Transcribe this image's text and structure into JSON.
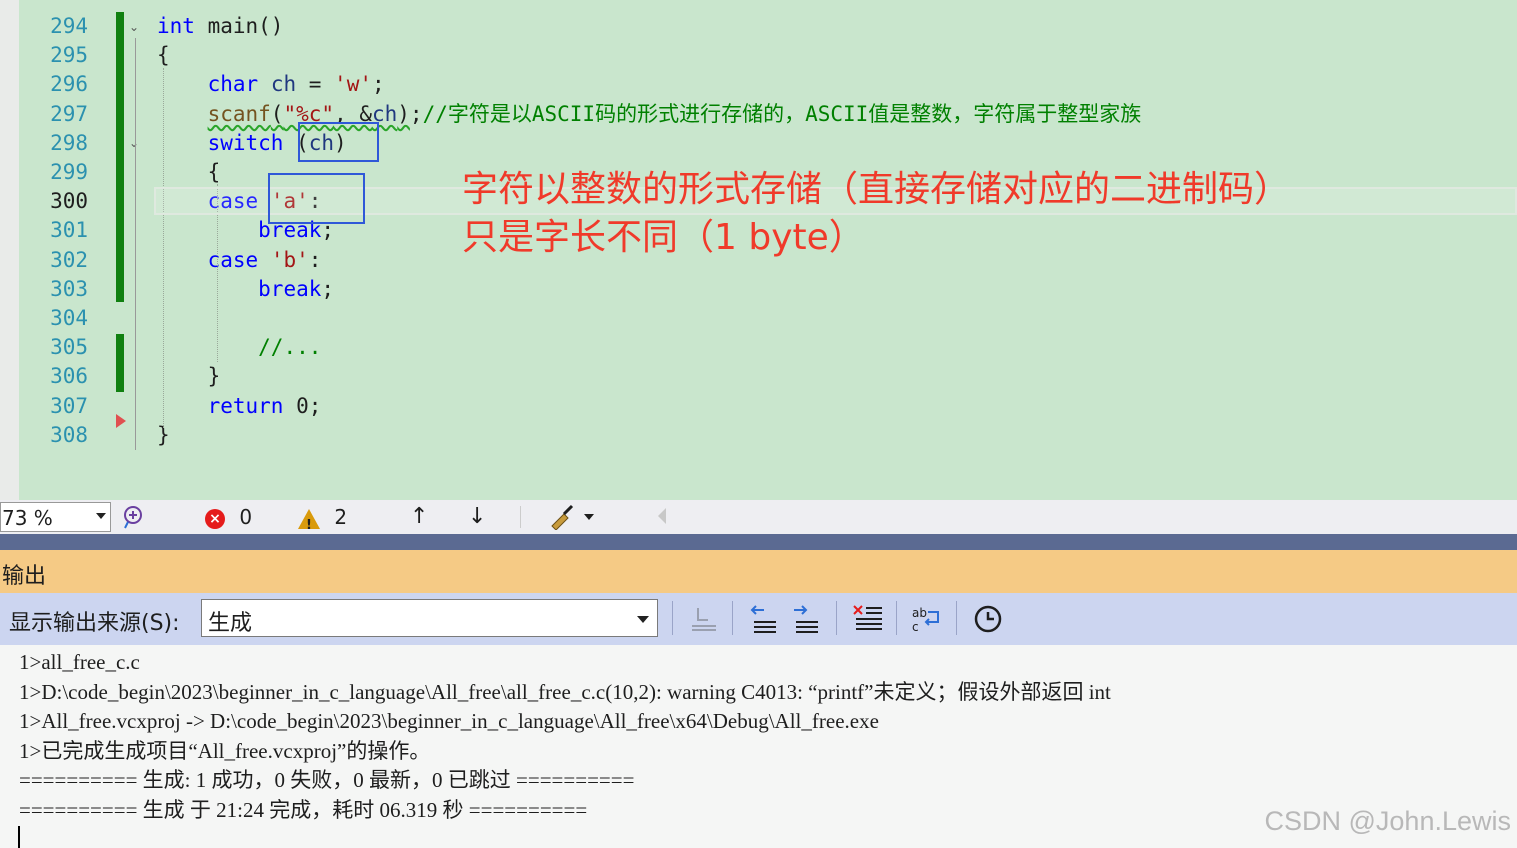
{
  "editor": {
    "lines": [
      {
        "num": "294",
        "tokens": [
          {
            "t": "int",
            "c": "kw"
          },
          {
            "t": " main()",
            "c": ""
          }
        ]
      },
      {
        "num": "295",
        "tokens": [
          {
            "t": "{",
            "c": ""
          }
        ]
      },
      {
        "num": "296",
        "tokens": [
          {
            "t": "    ",
            "c": ""
          },
          {
            "t": "char",
            "c": "kw"
          },
          {
            "t": " ",
            "c": ""
          },
          {
            "t": "ch",
            "c": "var"
          },
          {
            "t": " = ",
            "c": ""
          },
          {
            "t": "'w'",
            "c": "str"
          },
          {
            "t": ";",
            "c": ""
          }
        ]
      },
      {
        "num": "297",
        "tokens": [
          {
            "t": "    ",
            "c": ""
          },
          {
            "t": "scanf",
            "c": "fn sq"
          },
          {
            "t": "(",
            "c": "sq"
          },
          {
            "t": "\"%c\"",
            "c": "str sq"
          },
          {
            "t": ", &",
            "c": "sq"
          },
          {
            "t": "ch",
            "c": "var sq"
          },
          {
            "t": ")",
            "c": "sq"
          },
          {
            "t": ";",
            "c": ""
          },
          {
            "t": "//字符是以ASCII码的形式进行存储的，ASCII值是整数，字符属于整型家族",
            "c": "cmt"
          }
        ]
      },
      {
        "num": "298",
        "tokens": [
          {
            "t": "    ",
            "c": ""
          },
          {
            "t": "switch",
            "c": "kw"
          },
          {
            "t": " (",
            "c": ""
          },
          {
            "t": "ch",
            "c": "var"
          },
          {
            "t": ")",
            "c": ""
          }
        ]
      },
      {
        "num": "299",
        "tokens": [
          {
            "t": "    {",
            "c": ""
          }
        ]
      },
      {
        "num": "300",
        "tokens": [
          {
            "t": "    ",
            "c": ""
          },
          {
            "t": "case",
            "c": "kw"
          },
          {
            "t": " ",
            "c": ""
          },
          {
            "t": "'a'",
            "c": "str"
          },
          {
            "t": ":",
            "c": ""
          }
        ]
      },
      {
        "num": "301",
        "tokens": [
          {
            "t": "        ",
            "c": ""
          },
          {
            "t": "break",
            "c": "kw"
          },
          {
            "t": ";",
            "c": ""
          }
        ]
      },
      {
        "num": "302",
        "tokens": [
          {
            "t": "    ",
            "c": ""
          },
          {
            "t": "case",
            "c": "kw"
          },
          {
            "t": " ",
            "c": ""
          },
          {
            "t": "'b'",
            "c": "str"
          },
          {
            "t": ":",
            "c": ""
          }
        ]
      },
      {
        "num": "303",
        "tokens": [
          {
            "t": "        ",
            "c": ""
          },
          {
            "t": "break",
            "c": "kw"
          },
          {
            "t": ";",
            "c": ""
          }
        ]
      },
      {
        "num": "304",
        "tokens": []
      },
      {
        "num": "305",
        "tokens": [
          {
            "t": "        ",
            "c": ""
          },
          {
            "t": "//...",
            "c": "cmt"
          }
        ]
      },
      {
        "num": "306",
        "tokens": [
          {
            "t": "    }",
            "c": ""
          }
        ]
      },
      {
        "num": "307",
        "tokens": [
          {
            "t": "    ",
            "c": ""
          },
          {
            "t": "return",
            "c": "kw"
          },
          {
            "t": " 0;",
            "c": ""
          }
        ]
      },
      {
        "num": "308",
        "tokens": [
          {
            "t": "}",
            "c": ""
          }
        ]
      }
    ],
    "current_line": "300",
    "annotation": {
      "line1": "字符以整数的形式存储（直接存储对应的二进制码）",
      "line2": "只是字长不同（1 byte）"
    }
  },
  "statusbar": {
    "zoom": "73 %",
    "errors": "0",
    "warnings": "2",
    "icons": [
      "intellicode-icon",
      "error-icon",
      "warning-icon",
      "arrow-up-icon",
      "arrow-down-icon",
      "cleanup-brush-icon",
      "scroll-left-icon"
    ]
  },
  "output": {
    "title": "输出",
    "source_label": "显示输出来源(S):",
    "source_value": "生成",
    "lines": [
      "1>all_free_c.c",
      "1>D:\\code_begin\\2023\\beginner_in_c_language\\All_free\\all_free_c.c(10,2): warning C4013: “printf”未定义；假设外部返回 int",
      "1>All_free.vcxproj -> D:\\code_begin\\2023\\beginner_in_c_language\\All_free\\x64\\Debug\\All_free.exe",
      "1>已完成生成项目“All_free.vcxproj”的操作。",
      "========== 生成: 1 成功，0 失败，0 最新，0 已跳过 ==========",
      "========== 生成 于 21:24 完成，耗时 06.319 秒 =========="
    ]
  },
  "watermark": "CSDN @John.Lewis",
  "colors": {
    "editor_bg": "#c9e6cd",
    "keyword": "#0000ff",
    "string": "#a31515",
    "comment": "#008000",
    "annotation": "#f03a2a",
    "box": "#2f58d8",
    "output_title_bg": "#f5ca85"
  }
}
